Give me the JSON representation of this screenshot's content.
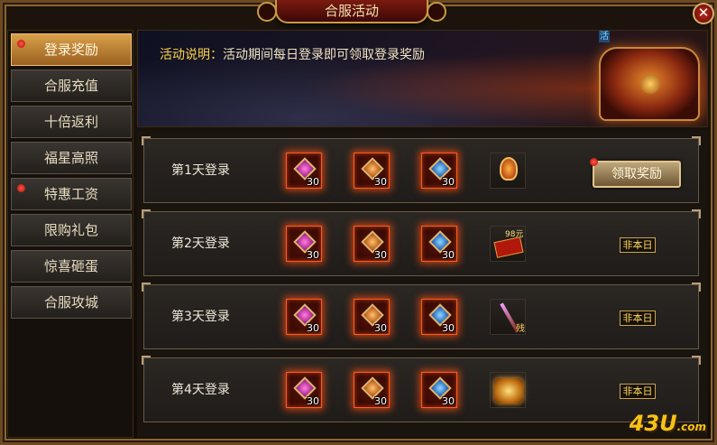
{
  "window": {
    "title": "合服活动",
    "close_icon": "close-icon"
  },
  "sidebar": {
    "items": [
      {
        "label": "登录奖励",
        "active": true,
        "badge": true
      },
      {
        "label": "合服充值",
        "active": false,
        "badge": false
      },
      {
        "label": "十倍返利",
        "active": false,
        "badge": false
      },
      {
        "label": "福星高照",
        "active": false,
        "badge": false
      },
      {
        "label": "特惠工资",
        "active": false,
        "badge": true
      },
      {
        "label": "限购礼包",
        "active": false,
        "badge": false
      },
      {
        "label": "惊喜砸蛋",
        "active": false,
        "badge": false
      },
      {
        "label": "合服攻城",
        "active": false,
        "badge": false
      }
    ]
  },
  "banner": {
    "label": "活动说明：",
    "text": "活动期间每日登录即可领取登录奖励",
    "corner_tag": "活"
  },
  "rewards": {
    "rows": [
      {
        "label": "第1天登录",
        "items": [
          {
            "gem": "pink",
            "qty": "30"
          },
          {
            "gem": "orange",
            "qty": "30"
          },
          {
            "gem": "blue",
            "qty": "30"
          }
        ],
        "special": "amulet",
        "special_text": "",
        "action": "领取奖励",
        "status": ""
      },
      {
        "label": "第2天登录",
        "items": [
          {
            "gem": "pink",
            "qty": "30"
          },
          {
            "gem": "orange",
            "qty": "30"
          },
          {
            "gem": "blue",
            "qty": "30"
          }
        ],
        "special": "ticket",
        "special_text": "98元",
        "action": "",
        "status": "非本日"
      },
      {
        "label": "第3天登录",
        "items": [
          {
            "gem": "pink",
            "qty": "30"
          },
          {
            "gem": "orange",
            "qty": "30"
          },
          {
            "gem": "blue",
            "qty": "30"
          }
        ],
        "special": "staff",
        "special_text": "残",
        "action": "",
        "status": "非本日"
      },
      {
        "label": "第4天登录",
        "items": [
          {
            "gem": "pink",
            "qty": "30"
          },
          {
            "gem": "orange",
            "qty": "30"
          },
          {
            "gem": "blue",
            "qty": "30"
          }
        ],
        "special": "chest",
        "special_text": "",
        "action": "",
        "status": "非本日"
      }
    ]
  },
  "watermark": {
    "main": "43U",
    "suffix": ".com"
  },
  "colors": {
    "accent": "#d9a04a",
    "status": "#ffd860",
    "glow": "#ff5a20"
  }
}
